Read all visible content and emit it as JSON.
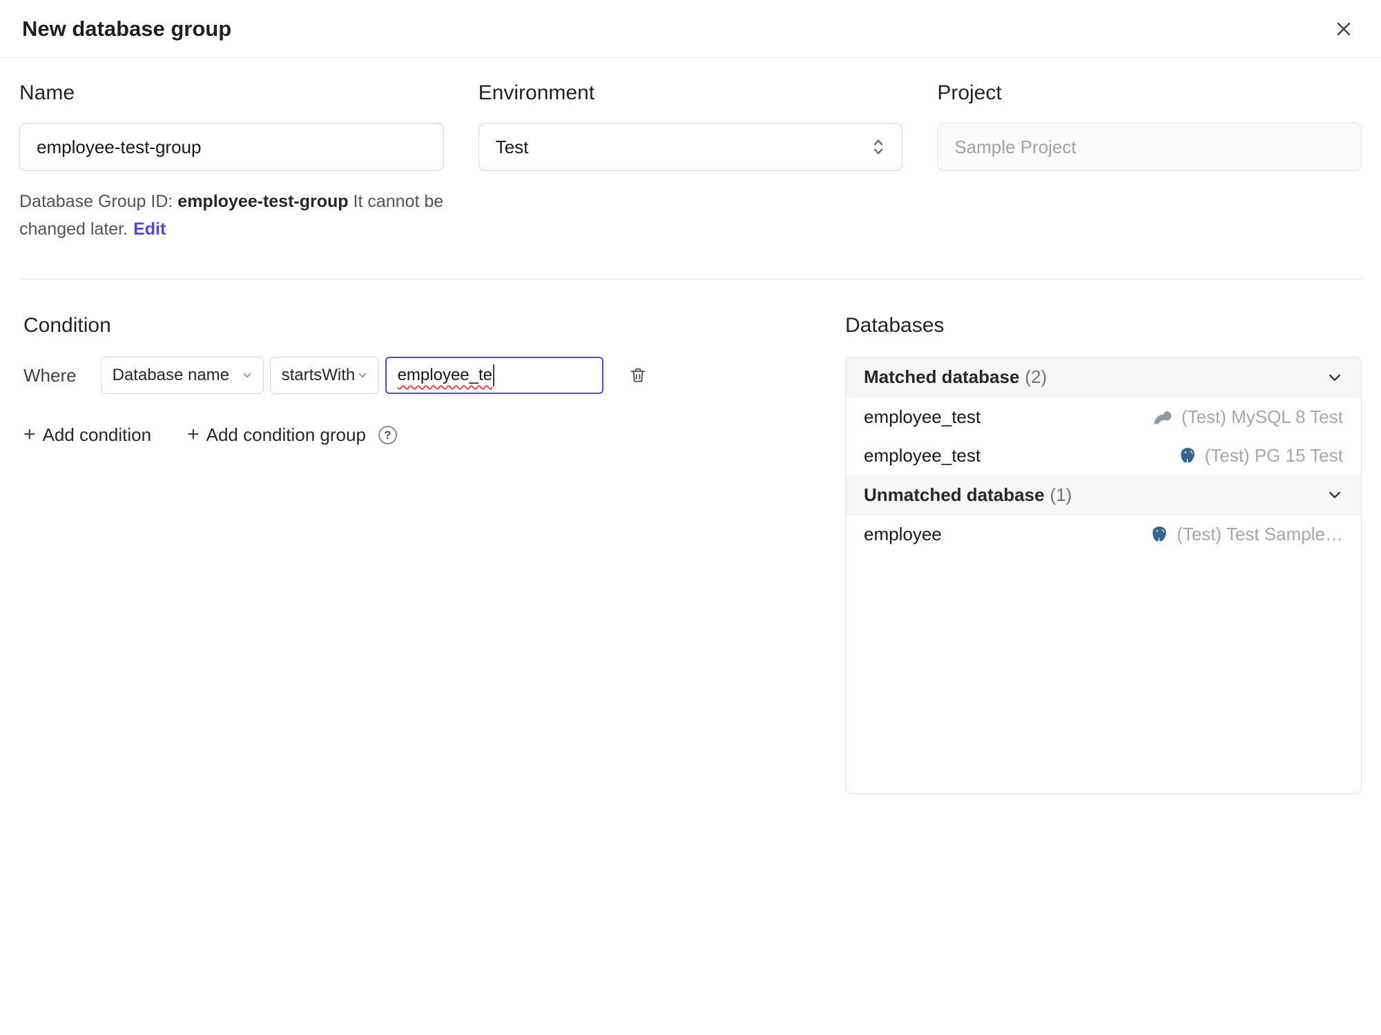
{
  "dialog": {
    "title": "New database group"
  },
  "form": {
    "name": {
      "label": "Name",
      "value": "employee-test-group"
    },
    "environment": {
      "label": "Environment",
      "value": "Test"
    },
    "project": {
      "label": "Project",
      "value": "Sample Project"
    },
    "group_id_note": {
      "prefix": "Database Group ID: ",
      "id": "employee-test-group",
      "suffix": " It cannot be changed later.",
      "edit_link": "Edit"
    }
  },
  "condition": {
    "heading": "Condition",
    "where_label": "Where",
    "field": "Database name",
    "operator": "startsWith",
    "value": "employee_te",
    "add_condition": "Add condition",
    "add_condition_group": "Add condition group"
  },
  "databases": {
    "heading": "Databases",
    "matched": {
      "title": "Matched database",
      "count": "(2)",
      "rows": [
        {
          "name": "employee_test",
          "engine": "mysql",
          "instance": "(Test) MySQL 8 Test"
        },
        {
          "name": "employee_test",
          "engine": "postgres",
          "instance": "(Test) PG 15 Test"
        }
      ]
    },
    "unmatched": {
      "title": "Unmatched database",
      "count": "(1)",
      "rows": [
        {
          "name": "employee",
          "engine": "postgres",
          "instance": "(Test) Test Sample…"
        }
      ]
    }
  },
  "icons": {
    "plus": "+",
    "help": "?"
  },
  "colors": {
    "accent": "#4f46e5",
    "focus_border": "#4f46e5",
    "postgres_icon": "#336791",
    "mysql_icon": "#8a9aa6",
    "muted_text": "#a6a6ae"
  }
}
